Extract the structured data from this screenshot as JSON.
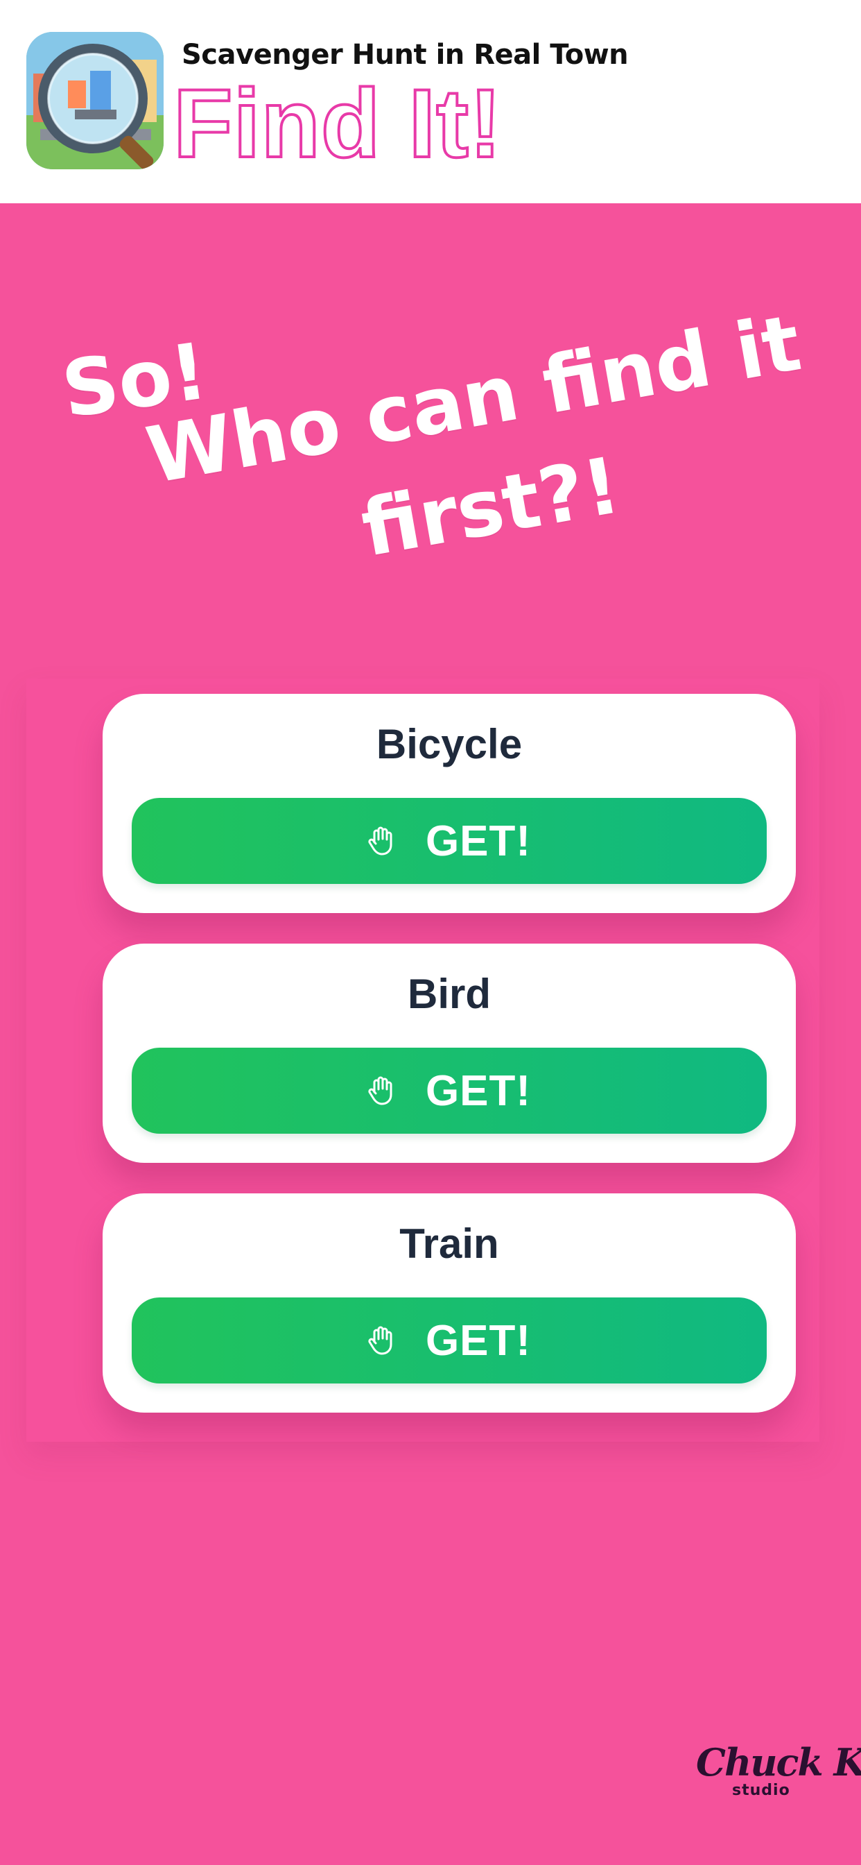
{
  "header": {
    "subtitle": "Scavenger Hunt in Real Town",
    "title": "Find It!",
    "app_icon": "magnifying-glass-town-icon"
  },
  "hero": {
    "line1": "So!",
    "line2": "Who can find it",
    "line3": "first?!"
  },
  "items": [
    {
      "name": "Bicycle",
      "button_label": "GET!",
      "icon": "hand-icon"
    },
    {
      "name": "Bird",
      "button_label": "GET!",
      "icon": "hand-icon"
    },
    {
      "name": "Train",
      "button_label": "GET!",
      "icon": "hand-icon"
    }
  ],
  "footer": {
    "studio_name": "Chuck K",
    "studio_sub": "studio"
  },
  "colors": {
    "background": "#f5529b",
    "title_pink": "#e83aa8",
    "button_green_start": "#21c35c",
    "button_green_end": "#10b981",
    "card_text": "#1f2a3c"
  }
}
